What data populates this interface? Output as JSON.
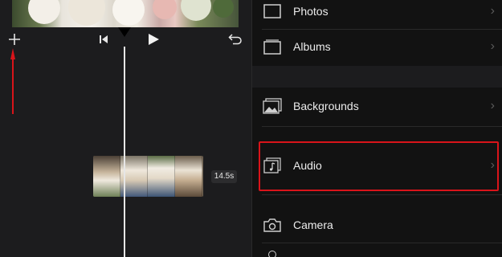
{
  "editor": {
    "duration_badge": "14.5s",
    "accent_arrow_color": "#d9141a"
  },
  "icons": {
    "add": "plus-icon",
    "skip_back": "skip-to-start-icon",
    "play": "play-icon",
    "undo": "undo-icon"
  },
  "picker": {
    "items": [
      {
        "label": "Photos",
        "icon": "photo-frame-icon"
      },
      {
        "label": "Albums",
        "icon": "albums-icon"
      },
      {
        "label": "Backgrounds",
        "icon": "backgrounds-icon"
      },
      {
        "label": "Audio",
        "icon": "music-note-icon",
        "highlighted": true
      },
      {
        "label": "Camera",
        "icon": "camera-icon"
      }
    ],
    "highlight_color": "#d9141a"
  }
}
